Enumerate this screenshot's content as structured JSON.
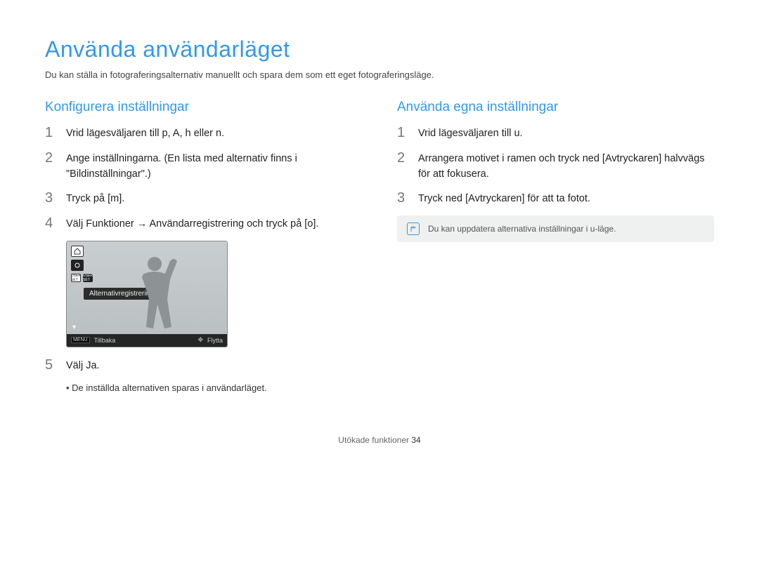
{
  "page_title": "Använda användarläget",
  "page_intro": "Du kan ställa in fotograferingsalternativ manuellt och spara dem som ett eget fotograferingsläge.",
  "left": {
    "heading": "Konﬁgurera inställningar",
    "steps": {
      "s1": "Vrid lägesväljaren till p, A, h eller n.",
      "s2": "Ange inställningarna. (En lista med alternativ ﬁnns i \"Bildinställningar\".)",
      "s3": "Tryck på [m].",
      "s4": "Välj Funktioner → Användarregistrering och tryck på [o].",
      "s5": "Välj Ja.",
      "s5_bullet": "De inställda alternativen sparas i användarläget."
    },
    "lcd": {
      "tooltip": "Alternativregistrering",
      "back": "Tillbaka",
      "move": "Flytta",
      "menu": "MENU"
    }
  },
  "right": {
    "heading": "Använda egna inställningar",
    "steps": {
      "s1": "Vrid lägesväljaren till u.",
      "s2": "Arrangera motivet i ramen och tryck ned [Avtryckaren] halvvägs för att fokusera.",
      "s3": "Tryck ned [Avtryckaren] för att ta fotot."
    },
    "note": "Du kan uppdatera alternativa inställningar i u-läge."
  },
  "footer": {
    "section": "Utökade funktioner",
    "page": "34"
  }
}
